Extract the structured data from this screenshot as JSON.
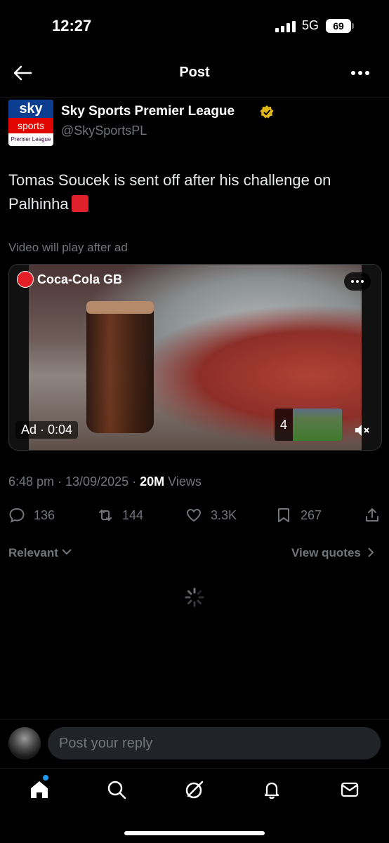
{
  "status_bar": {
    "time": "12:27",
    "network": "5G",
    "battery": "69"
  },
  "header": {
    "title": "Post",
    "back_icon": "arrow-left-icon",
    "more_icon": "more-horizontal-icon"
  },
  "author": {
    "logo_top": "sky",
    "logo_mid": "sports",
    "logo_bot": "Premier League",
    "name": "Sky Sports Premier League",
    "handle": "@SkySportsPL",
    "verified_color": "#e2b719"
  },
  "tweet": {
    "text": "Tomas Soucek is sent off after his challenge on Palhinha"
  },
  "media": {
    "note": "Video will play after ad",
    "sponsor": "Coca-Cola GB",
    "ad_label": "Ad · 0:04",
    "next_count": "4"
  },
  "meta": {
    "timestamp": "6:48 pm · 13/09/2025 · ",
    "views_count": "20M",
    "views_label": " Views"
  },
  "actions": {
    "replies": "136",
    "reposts": "144",
    "likes": "3.3K",
    "bookmarks": "267"
  },
  "replies_section": {
    "sort_label": "Relevant",
    "view_quotes": "View quotes"
  },
  "reply_bar": {
    "placeholder": "Post your reply"
  },
  "tabs": [
    "home-icon",
    "search-icon",
    "grok-icon",
    "notifications-icon",
    "messages-icon"
  ],
  "colors": {
    "background": "#000000",
    "text": "#e7e9ea",
    "muted": "#71767b",
    "accent": "#1d9bf0",
    "red_card": "#e0202a"
  }
}
